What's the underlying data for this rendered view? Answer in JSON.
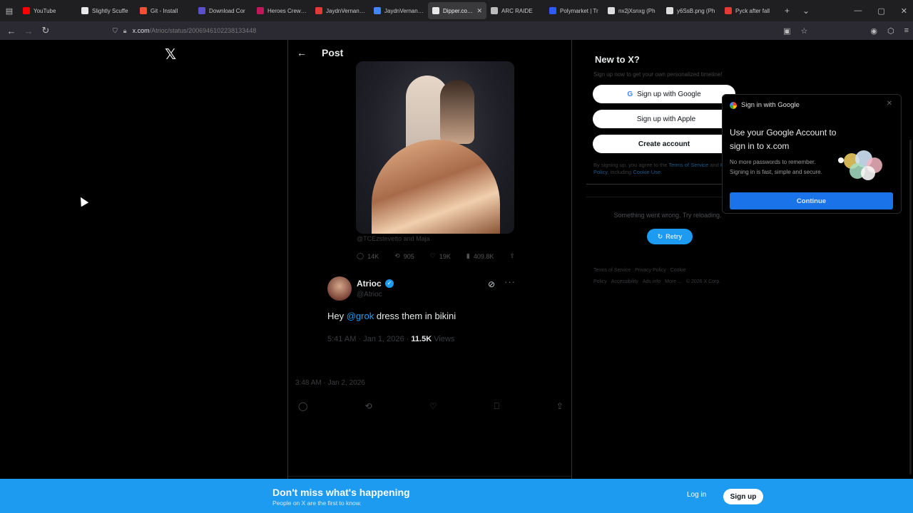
{
  "browser": {
    "tabs": [
      {
        "label": "YouTube",
        "color": "#ff0000"
      },
      {
        "label": "Slightly Scuffe",
        "color": "#e8e8e8"
      },
      {
        "label": "Git - Install",
        "color": "#f05033"
      },
      {
        "label": "Download Cor",
        "color": "#5a4fcf"
      },
      {
        "label": "Heroes Crew m",
        "color": "#c2185b"
      },
      {
        "label": "JaydnVernando",
        "color": "#e53935"
      },
      {
        "label": "JaydnVernando",
        "color": "#4285f4"
      },
      {
        "label": "Dipper.com X",
        "color": "#e8e8e8",
        "active": true
      },
      {
        "label": "ARC RAIDE",
        "color": "#bbbbbb"
      },
      {
        "label": "Polymarket | Tr",
        "color": "#2e5bff"
      },
      {
        "label": "nx2jXsnxg (Ph",
        "color": "#dddddd"
      },
      {
        "label": "y6SsB.png (Ph",
        "color": "#dddddd"
      },
      {
        "label": "Pyck after fall",
        "color": "#e53935"
      }
    ],
    "url_host": "x.com",
    "url_path": "/Atrioc/status/2006946102238133448"
  },
  "post_header": {
    "title": "Post"
  },
  "quoted": {
    "credit": "@TCEzstevetto and Maja",
    "replies": "14K",
    "reposts": "905",
    "likes": "19K",
    "views": "409.8K"
  },
  "tweet": {
    "author": "Atrioc",
    "handle": "@Atrioc",
    "text_before": "Hey ",
    "mention": "@grok",
    "text_after": " dress them in bikini",
    "time": "5:41 AM · Jan 1, 2026 · ",
    "views": "11.5K",
    "views_label": " Views"
  },
  "reply": {
    "time": "3:48 AM · Jan 2, 2026"
  },
  "sidebar": {
    "title": "New to X?",
    "subtitle": "Sign up now to get your own personalized timeline!",
    "google_label": "Sign up with Google",
    "apple_label": "Sign up with Apple",
    "create_label": "Create account",
    "terms_prefix": "By signing up, you agree to the ",
    "terms_link": "Terms of Service",
    "terms_mid": " and ",
    "privacy_link": "Privacy Policy",
    "cookie_prefix": ", including ",
    "cookie_link": "Cookie Use.",
    "error_text": "Something went wrong. Try reloading.",
    "retry_label": "Retry",
    "footer_links": [
      "Terms of Service",
      "Privacy Policy",
      "Cookie Policy",
      "Accessibility",
      "Ads info",
      "More ...",
      "© 2026 X Corp."
    ]
  },
  "google_popup": {
    "header": "Sign in with Google",
    "title": "Use your Google Account to sign in to x.com",
    "desc": "No more passwords to remember. Signing in is fast, simple and secure.",
    "continue_label": "Continue"
  },
  "banner": {
    "title": "Don't miss what's happening",
    "subtitle": "People on X are the first to know.",
    "login_label": "Log in",
    "signup_label": "Sign up"
  },
  "colors": {
    "accent": "#1d9bf0",
    "google_blue": "#1a73e8"
  }
}
